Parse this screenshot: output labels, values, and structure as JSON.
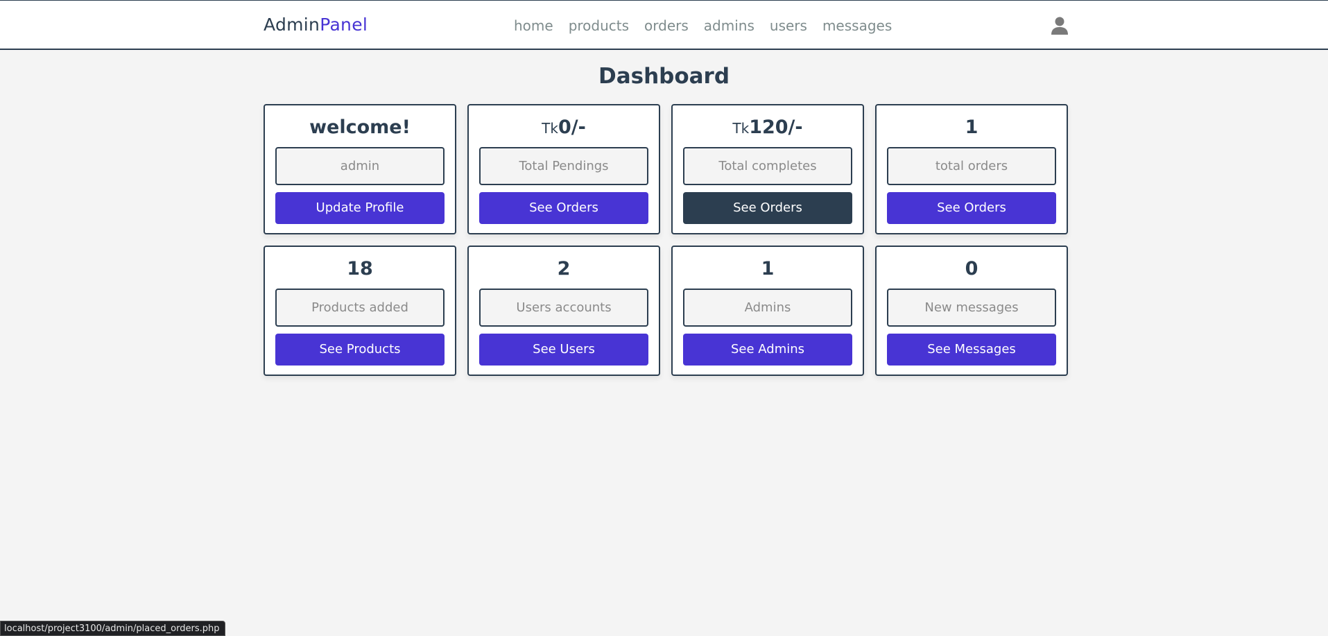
{
  "header": {
    "logo_main": "Admin",
    "logo_accent": "Panel",
    "nav": [
      "home",
      "products",
      "orders",
      "admins",
      "users",
      "messages"
    ],
    "user_icon": "user-icon"
  },
  "page_title": "Dashboard",
  "cards": [
    {
      "value": "welcome!",
      "label": "admin",
      "button": "Update Profile"
    },
    {
      "currency": "Tk",
      "value": "0/-",
      "label": "Total Pendings",
      "button": "See Orders"
    },
    {
      "currency": "Tk",
      "value": "120/-",
      "label": "Total completes",
      "button": "See Orders"
    },
    {
      "value": "1",
      "label": "total orders",
      "button": "See Orders"
    },
    {
      "value": "18",
      "label": "Products added",
      "button": "See Products"
    },
    {
      "value": "2",
      "label": "Users accounts",
      "button": "See Users"
    },
    {
      "value": "1",
      "label": "Admins",
      "button": "See Admins"
    },
    {
      "value": "0",
      "label": "New messages",
      "button": "See Messages"
    }
  ],
  "colors": {
    "accent": "#4834d4",
    "dark": "#2c3e50",
    "background": "#f4f4f4"
  },
  "status_bar": "localhost/project3100/admin/placed_orders.php"
}
